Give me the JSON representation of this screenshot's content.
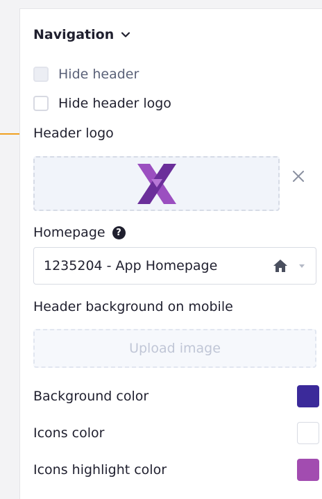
{
  "section": {
    "title": "Navigation"
  },
  "checkboxes": [
    {
      "label": "Hide header",
      "checked": false,
      "muted": true
    },
    {
      "label": "Hide header logo",
      "checked": false,
      "muted": false
    }
  ],
  "header_logo": {
    "label": "Header logo",
    "logo_letter": "X"
  },
  "homepage": {
    "label": "Homepage",
    "help": "?",
    "value": "1235204 - App Homepage"
  },
  "mobile_background": {
    "label": "Header background on mobile",
    "upload_label": "Upload image"
  },
  "colors": [
    {
      "label": "Background color",
      "color": "#3b2a9a"
    },
    {
      "label": "Icons color",
      "color": "#ffffff"
    },
    {
      "label": "Icons highlight color",
      "color": "#a24cb0"
    }
  ],
  "theme": {
    "accent": "#f0a020",
    "logo_primary": "#8e44ad",
    "logo_secondary": "#5b2a86"
  }
}
